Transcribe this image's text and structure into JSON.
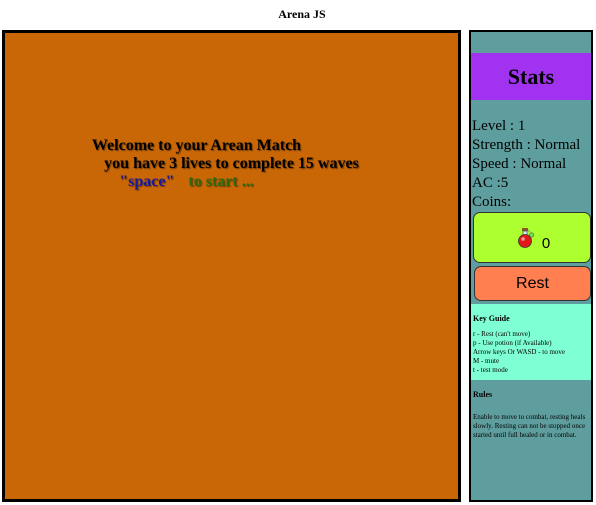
{
  "page": {
    "title": "Arena JS"
  },
  "arena": {
    "welcome_line1": "Welcome to your Arean Match",
    "welcome_line2": "you have 3 lives to complete 15 waves",
    "space_key": "\"space\"",
    "to_start": "to start ..."
  },
  "sidebar": {
    "heading": "Stats",
    "level": "Level : 1",
    "strength": "Strength : Normal",
    "speed": "Speed : Normal",
    "ac": "AC :5",
    "coins": "Coins:",
    "potion_icon": "potion-icon",
    "potion_count": "0",
    "rest_label": "Rest"
  },
  "key_guide": {
    "title": "Key Guide",
    "lines": [
      "r - Rest (can't move)",
      "p - Use potion (if Available)",
      "Arrow keys Or WASD - to move",
      "M - mute",
      "t - test mode"
    ]
  },
  "rules": {
    "title": "Rules",
    "text": "Enable to move to combat, resting heals slowly. Resting can not be stopped once started until full healed or in combat."
  },
  "colors": {
    "arena": "#c96707",
    "sidebar": "#5f9e9e",
    "stats_header": "#a133f0",
    "potion_button": "#adff2f",
    "rest_button": "#ff7f50",
    "key_guide": "#7fffd4"
  }
}
